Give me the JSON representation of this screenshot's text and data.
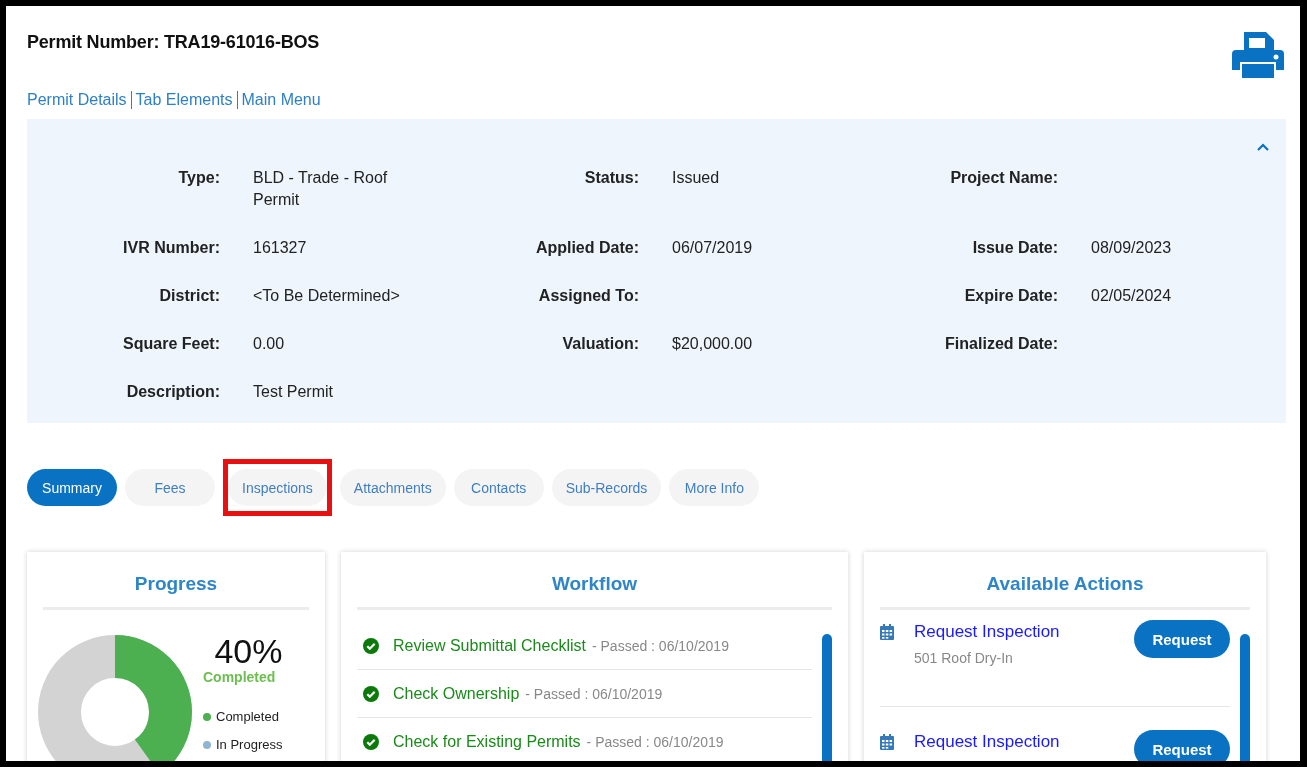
{
  "header": {
    "title": "Permit Number: TRA19-61016-BOS",
    "links": [
      "Permit Details",
      "Tab Elements",
      "Main Menu"
    ]
  },
  "details": {
    "expanded": true,
    "rows": [
      [
        {
          "label": "Type:",
          "value": "BLD - Trade - Roof Permit"
        },
        {
          "label": "Status:",
          "value": "Issued"
        },
        {
          "label": "Project Name:"
        }
      ],
      [
        {
          "label": "IVR Number:",
          "value": "161327"
        },
        {
          "label": "Applied Date:",
          "value": "06/07/2019"
        },
        {
          "label": "Issue Date:",
          "value": "08/09/2023"
        }
      ],
      [
        {
          "label": "District:",
          "value": "<To Be Determined>"
        },
        {
          "label": "Assigned To:"
        },
        {
          "label": "Expire Date:",
          "value": "02/05/2024"
        }
      ],
      [
        {
          "label": "Square Feet:",
          "value": "0.00"
        },
        {
          "label": "Valuation:",
          "value": "$20,000.00"
        },
        {
          "label": "Finalized Date:"
        }
      ],
      [
        {
          "label": "Description:",
          "value": "Test Permit"
        }
      ]
    ]
  },
  "tabs": [
    {
      "label": "Summary",
      "selected": true,
      "highlighted": false
    },
    {
      "label": "Fees",
      "selected": false,
      "highlighted": false
    },
    {
      "label": "Inspections",
      "selected": false,
      "highlighted": true
    },
    {
      "label": "Attachments",
      "selected": false,
      "highlighted": false
    },
    {
      "label": "Contacts",
      "selected": false,
      "highlighted": false
    },
    {
      "label": "Sub-Records",
      "selected": false,
      "highlighted": false
    },
    {
      "label": "More Info",
      "selected": false,
      "highlighted": false
    }
  ],
  "progress": {
    "title": "Progress",
    "percent": "40%",
    "percent_label": "Completed",
    "level": 0.4,
    "legend": [
      {
        "label": "Completed",
        "color": "#4caf50"
      },
      {
        "label": "In Progress",
        "color": "#8fb5d3"
      }
    ]
  },
  "workflow": {
    "title": "Workflow",
    "items": [
      {
        "name": "Review Submittal Checklist",
        "detail": "- Passed : 06/10/2019"
      },
      {
        "name": "Check Ownership",
        "detail": "- Passed : 06/10/2019"
      },
      {
        "name": "Check for Existing Permits",
        "detail": "- Passed : 06/10/2019"
      }
    ]
  },
  "actions": {
    "title": "Available Actions",
    "items": [
      {
        "title": "Request Inspection",
        "subtitle": "501 Roof Dry-In",
        "button": "Request"
      },
      {
        "title": "Request Inspection",
        "button": "Request"
      }
    ]
  }
}
